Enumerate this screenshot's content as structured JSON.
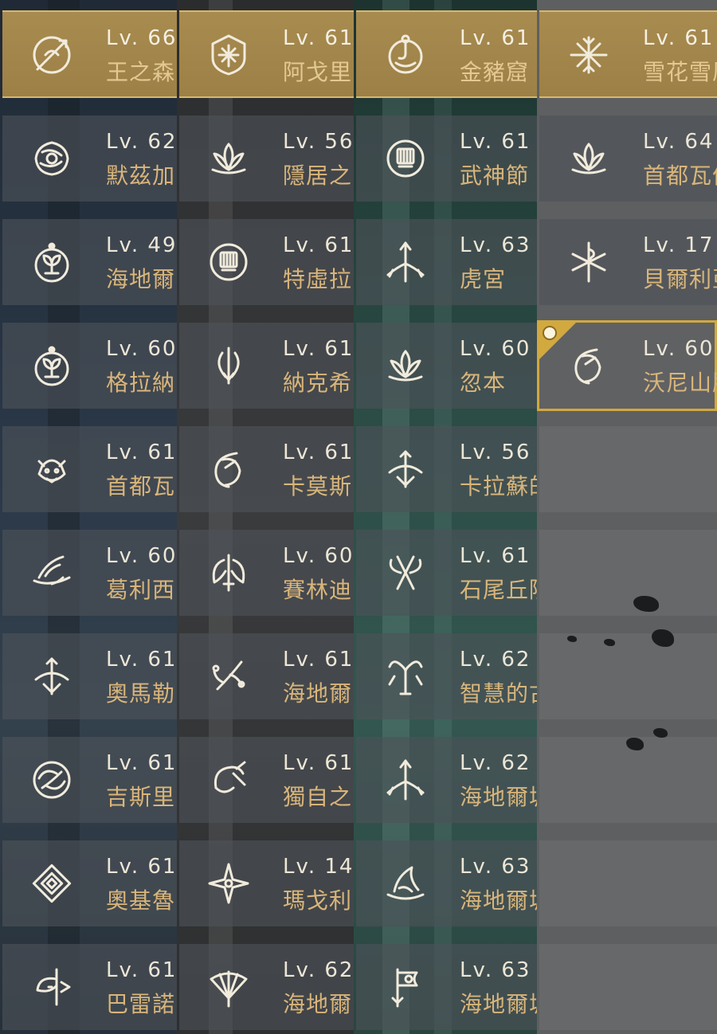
{
  "colors": {
    "gold": "#d9b57a",
    "highlight": "#a88b4f",
    "selected_border": "#d1a93f",
    "level_text": "#ece6d6"
  },
  "columns": [
    {
      "cards": [
        {
          "level": "Lv. 66",
          "name": "王之森",
          "icon": "spear-crescent-icon",
          "state": "highlight"
        },
        {
          "level": "Lv. 62",
          "name": "默茲加",
          "icon": "rose-icon",
          "state": "normal"
        },
        {
          "level": "Lv. 49",
          "name": "海地爾",
          "icon": "flower-emblem-icon",
          "state": "normal"
        },
        {
          "level": "Lv. 60",
          "name": "格拉納",
          "icon": "flower-emblem-icon",
          "state": "normal"
        },
        {
          "level": "Lv. 61",
          "name": "首都瓦",
          "icon": "dragon-head-icon",
          "state": "normal"
        },
        {
          "level": "Lv. 60",
          "name": "葛利西",
          "icon": "wing-icon",
          "state": "normal"
        },
        {
          "level": "Lv. 61",
          "name": "奧馬勒",
          "icon": "crossbow-icon",
          "state": "normal"
        },
        {
          "level": "Lv. 61",
          "name": "吉斯里",
          "icon": "swirl-icon",
          "state": "normal"
        },
        {
          "level": "Lv. 61",
          "name": "奧基魯",
          "icon": "diamond-pattern-icon",
          "state": "normal"
        },
        {
          "level": "Lv. 61",
          "name": "巴雷諾",
          "icon": "axe-star-icon",
          "state": "normal"
        }
      ]
    },
    {
      "cards": [
        {
          "level": "Lv. 61",
          "name": "阿戈里",
          "icon": "shield-star-icon",
          "state": "highlight"
        },
        {
          "level": "Lv. 56",
          "name": "隱居之",
          "icon": "lotus-icon",
          "state": "normal"
        },
        {
          "level": "Lv. 61",
          "name": "特虛拉",
          "icon": "fist-emblem-icon",
          "state": "normal"
        },
        {
          "level": "Lv. 61",
          "name": "納克希",
          "icon": "flame-trident-icon",
          "state": "normal"
        },
        {
          "level": "Lv. 61",
          "name": "卡莫斯",
          "icon": "crescent-claw-icon",
          "state": "normal"
        },
        {
          "level": "Lv. 60",
          "name": "賽林迪",
          "icon": "winged-sword-icon",
          "state": "normal"
        },
        {
          "level": "Lv. 61",
          "name": "海地爾",
          "icon": "branch-icon",
          "state": "normal"
        },
        {
          "level": "Lv. 61",
          "name": "獨自之",
          "icon": "horn-dagger-icon",
          "state": "normal"
        },
        {
          "level": "Lv. 14",
          "name": "瑪戈利",
          "icon": "compass-star-icon",
          "state": "normal"
        },
        {
          "level": "Lv. 62",
          "name": "海地爾",
          "icon": "fan-icon",
          "state": "normal"
        }
      ]
    },
    {
      "cards": [
        {
          "level": "Lv. 61",
          "name": "金豬窟",
          "icon": "ring-hook-icon",
          "state": "highlight"
        },
        {
          "level": "Lv. 61",
          "name": "武神節",
          "icon": "fist-emblem-icon",
          "state": "normal"
        },
        {
          "level": "Lv. 63",
          "name": "虎宮",
          "icon": "arrow-wing-icon",
          "state": "normal"
        },
        {
          "level": "Lv. 60",
          "name": "忽本",
          "icon": "lotus-icon",
          "state": "normal"
        },
        {
          "level": "Lv. 56",
          "name": "卡拉蘇的",
          "icon": "crossbow-icon",
          "state": "normal"
        },
        {
          "level": "Lv. 61",
          "name": "石尾丘陵",
          "icon": "twin-axe-icon",
          "state": "normal"
        },
        {
          "level": "Lv. 62",
          "name": "智慧的古",
          "icon": "crab-icon",
          "state": "normal"
        },
        {
          "level": "Lv. 62",
          "name": "海地爾城",
          "icon": "arrow-wing-icon",
          "state": "normal"
        },
        {
          "level": "Lv. 63",
          "name": "海地爾城",
          "icon": "wave-hat-icon",
          "state": "normal"
        },
        {
          "level": "Lv. 63",
          "name": "海地爾城",
          "icon": "banner-axe-icon",
          "state": "normal"
        }
      ]
    },
    {
      "cards": [
        {
          "level": "Lv. 61",
          "name": "雪花雪原",
          "icon": "snowflake-rune-icon",
          "state": "highlight"
        },
        {
          "level": "Lv. 64",
          "name": "首都瓦倫",
          "icon": "lotus-icon",
          "state": "normal"
        },
        {
          "level": "Lv. 17",
          "name": "貝爾利亞",
          "icon": "serpent-star-icon",
          "state": "normal"
        },
        {
          "level": "Lv. 60",
          "name": "沃尼山脈",
          "icon": "crescent-claw-icon",
          "state": "selected"
        }
      ],
      "empty_rows": 6
    }
  ]
}
